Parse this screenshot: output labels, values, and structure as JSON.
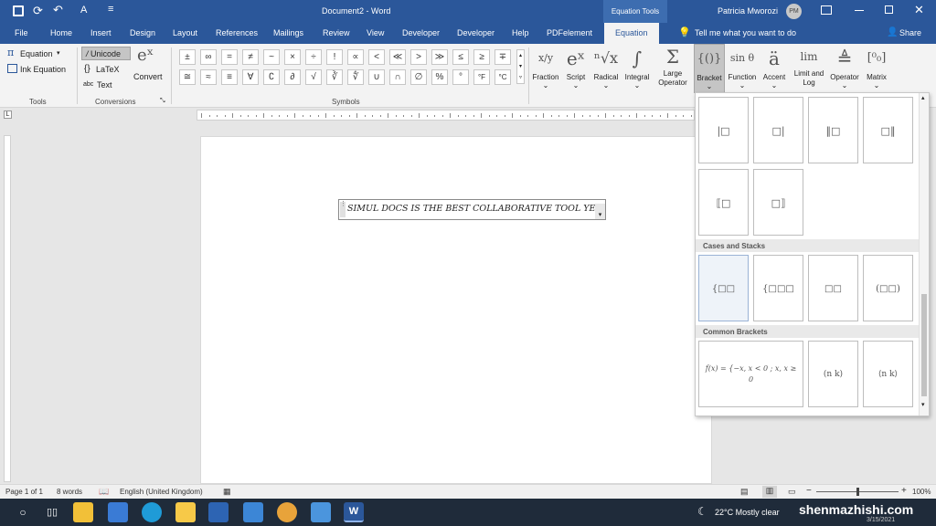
{
  "titlebar": {
    "doc_title": "Document2  -  Word",
    "context_tab": "Equation Tools",
    "user_name": "Patricia Mworozi",
    "user_initials": "PM"
  },
  "tabs": [
    "File",
    "Home",
    "Insert",
    "Design",
    "Layout",
    "References",
    "Mailings",
    "Review",
    "View",
    "Developer",
    "Developer",
    "Help",
    "PDFelement",
    "Equation"
  ],
  "tell_me": "Tell me what you want to do",
  "share": "Share",
  "ribbon": {
    "tools": {
      "equation": "Equation",
      "ink": "Ink Equation",
      "label": "Tools"
    },
    "conversions": {
      "unicode": "Unicode",
      "latex": "LaTeX",
      "text": "Text",
      "convert": "Convert",
      "label": "Conversions"
    },
    "symbols_label": "Symbols",
    "symbols_row1": [
      "±",
      "∞",
      "=",
      "≠",
      "~",
      "×",
      "÷",
      "!",
      "∝",
      "<",
      "≪",
      ">",
      "≫",
      "≤",
      "≥",
      "∓"
    ],
    "symbols_row2": [
      "≅",
      "≈",
      "≡",
      "∀",
      "∁",
      "∂",
      "√",
      "∛",
      "∜",
      "∪",
      "∩",
      "∅",
      "%",
      "°",
      "°F",
      "°C"
    ],
    "structures": [
      {
        "label": "Fraction",
        "glyph": "x/y"
      },
      {
        "label": "Script",
        "glyph": "eˣ"
      },
      {
        "label": "Radical",
        "glyph": "ⁿ√x"
      },
      {
        "label": "Integral",
        "glyph": "∫"
      },
      {
        "label": "Large Operator",
        "glyph": "Σ"
      },
      {
        "label": "Bracket",
        "glyph": "{()}"
      },
      {
        "label": "Function",
        "glyph": "sin θ"
      },
      {
        "label": "Accent",
        "glyph": "ä"
      },
      {
        "label": "Limit and Log",
        "glyph": "lim"
      },
      {
        "label": "Operator",
        "glyph": "≜"
      },
      {
        "label": "Matrix",
        "glyph": "[⁰₀]"
      }
    ]
  },
  "document": {
    "equation_text": "SIMUL DOCS IS THE BEST COLLABORATIVE TOOL YET"
  },
  "gallery": {
    "row1": [
      "|□",
      "□|",
      "‖□",
      "□‖"
    ],
    "row2": [
      "⟦□",
      "□⟧"
    ],
    "cases_header": "Cases and Stacks",
    "cases": [
      "{□□",
      "{□□□",
      "□□",
      "(□□)"
    ],
    "common_header": "Common Brackets",
    "common_f": "f(x) = {−x,    x < 0 ;  x,    x ≥ 0",
    "binom1": "(n k)",
    "binom2": "⟨n k⟩"
  },
  "status": {
    "page": "Page 1 of 1",
    "words": "8 words",
    "language": "English (United Kingdom)",
    "zoom": "100%"
  },
  "taskbar": {
    "weather": "22°C  Mostly clear",
    "watermark": "shenmazhishi.com",
    "date": "3/15/2021"
  },
  "colors": {
    "accent": "#2b579a",
    "taskbar": "#1f2b3a"
  }
}
